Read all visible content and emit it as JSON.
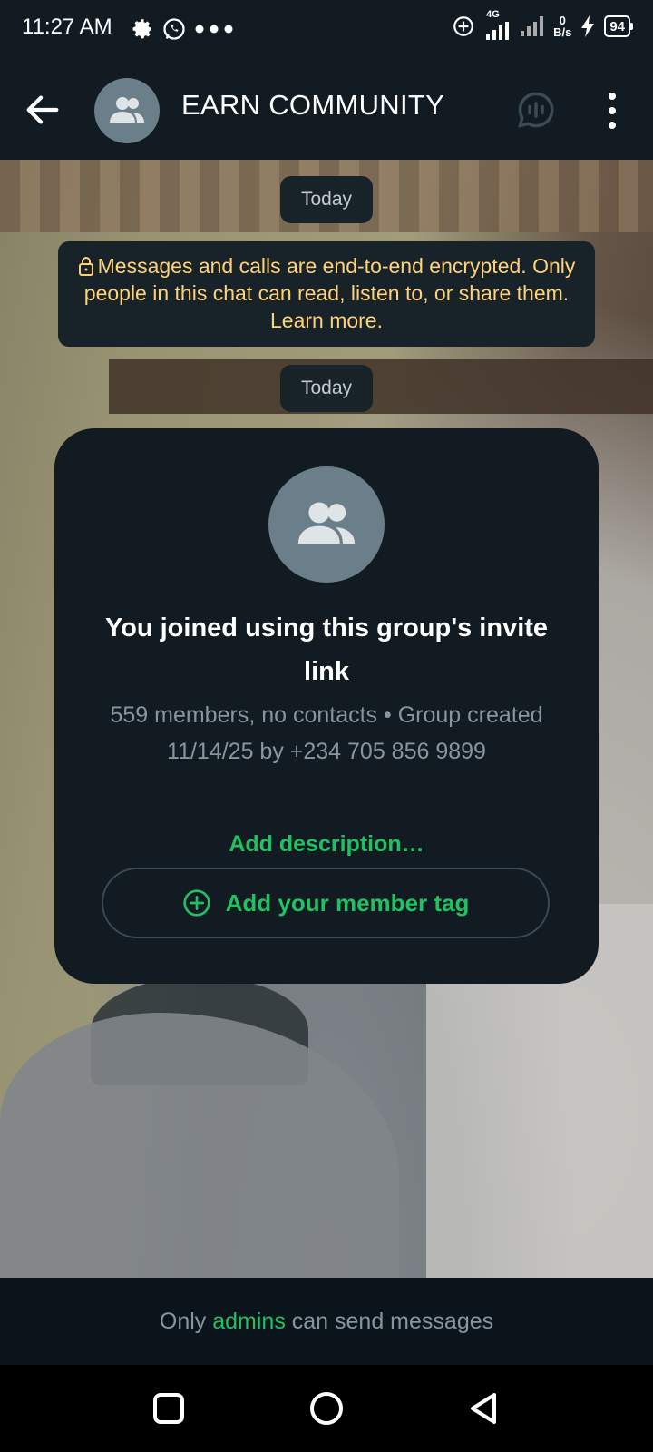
{
  "status_bar": {
    "time": "11:27 AM",
    "network_type": "4G",
    "data_speed_value": "0",
    "data_speed_unit": "B/s",
    "battery": "94"
  },
  "app_bar": {
    "title": "EARN COMMUNITY"
  },
  "chat": {
    "date_pill_1": "Today",
    "encryption_notice": "Messages and calls are end-to-end encrypted. Only people in this chat can read, listen to, or share them. Learn more.",
    "date_pill_2": "Today",
    "group_card": {
      "title": "You joined using this group's invite link",
      "meta": "559 members, no contacts • Group created 11/14/25 by +234 705 856 9899",
      "add_description": "Add description…",
      "member_tag_button": "Add your member tag"
    }
  },
  "footer": {
    "prefix": "Only ",
    "link": "admins",
    "suffix": " can send messages"
  },
  "colors": {
    "accent_green": "#21c063",
    "encryption_yellow": "#ffd279",
    "bar_bg": "#111b21"
  }
}
